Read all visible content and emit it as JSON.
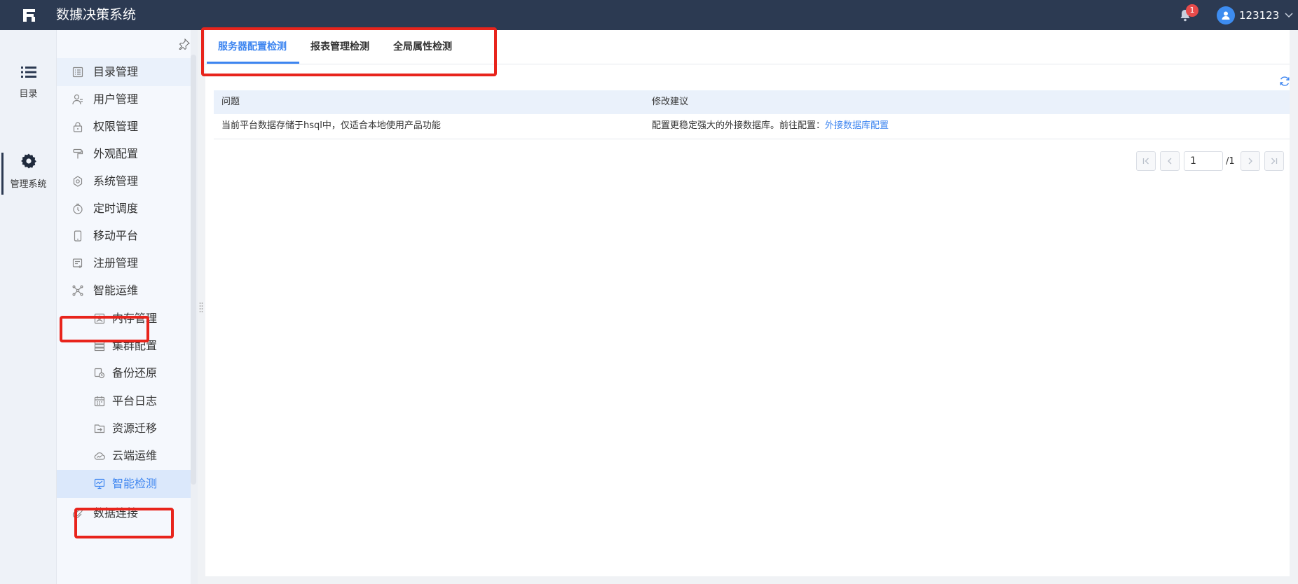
{
  "app": {
    "title": "数據决策系统"
  },
  "header": {
    "notification_count": "1",
    "username": "123123"
  },
  "rail": [
    {
      "label": "目录",
      "icon": "list-icon"
    },
    {
      "label": "管理系统",
      "icon": "gear-icon"
    }
  ],
  "sidebar": {
    "items": [
      {
        "label": "目录管理",
        "icon": "catalog-icon"
      },
      {
        "label": "用户管理",
        "icon": "user-icon"
      },
      {
        "label": "权限管理",
        "icon": "lock-icon"
      },
      {
        "label": "外观配置",
        "icon": "paint-roller-icon"
      },
      {
        "label": "系统管理",
        "icon": "settings-icon"
      },
      {
        "label": "定时调度",
        "icon": "timer-icon"
      },
      {
        "label": "移动平台",
        "icon": "mobile-icon"
      },
      {
        "label": "注册管理",
        "icon": "register-icon"
      },
      {
        "label": "智能运维",
        "icon": "ops-icon"
      }
    ],
    "sub_items": [
      {
        "label": "内存管理",
        "icon": "memory-icon"
      },
      {
        "label": "集群配置",
        "icon": "cluster-icon"
      },
      {
        "label": "备份还原",
        "icon": "backup-icon"
      },
      {
        "label": "平台日志",
        "icon": "calendar-log-icon"
      },
      {
        "label": "资源迁移",
        "icon": "migrate-icon"
      },
      {
        "label": "云端运维",
        "icon": "cloud-icon"
      },
      {
        "label": "智能检测",
        "icon": "monitor-icon"
      }
    ],
    "bottom_item": {
      "label": "数据连接",
      "icon": "link-icon"
    }
  },
  "tabs": [
    {
      "label": "服务器配置检测"
    },
    {
      "label": "报表管理检测"
    },
    {
      "label": "全局属性检测"
    }
  ],
  "table": {
    "columns": [
      "问题",
      "修改建议"
    ],
    "rows": [
      {
        "issue": "当前平台数据存储于hsql中，仅适合本地使用产品功能",
        "suggestion": "配置更稳定强大的外接数据库。前往配置：",
        "link": "外接数据库配置"
      }
    ]
  },
  "pager": {
    "current": "1",
    "total": "/1"
  },
  "colors": {
    "accent": "#3d85f0",
    "header_bg": "#2c3a52",
    "annotation": "#e8241c"
  }
}
